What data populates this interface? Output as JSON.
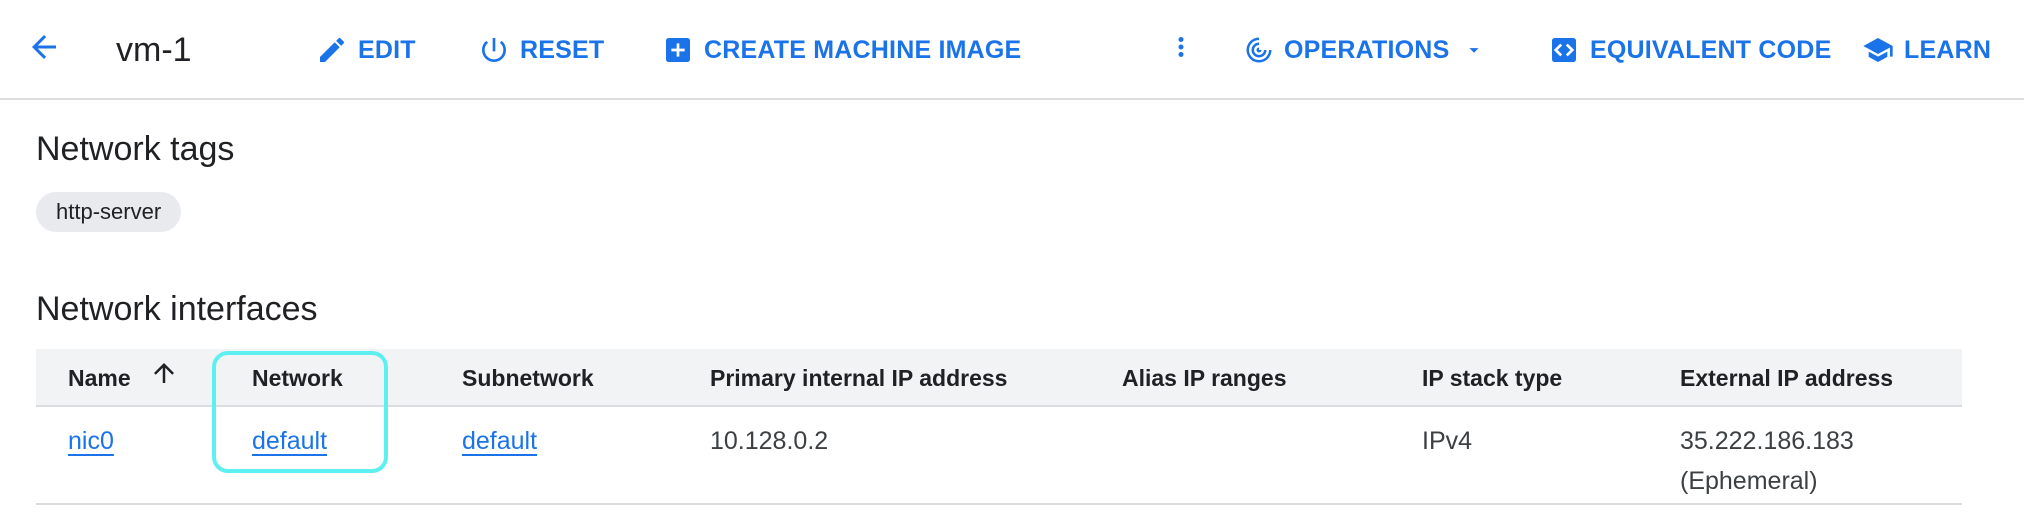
{
  "toolbar": {
    "title": "vm-1",
    "edit_label": "EDIT",
    "reset_label": "RESET",
    "create_image_label": "CREATE MACHINE IMAGE",
    "operations_label": "OPERATIONS",
    "equivalent_code_label": "EQUIVALENT CODE",
    "learn_label": "LEARN",
    "icons": [
      "back-arrow-icon",
      "pencil-icon",
      "power-icon",
      "add-box-icon",
      "more-vert-icon",
      "operations-icon",
      "dropdown-icon",
      "code-icon",
      "learn-icon"
    ]
  },
  "network_tags": {
    "heading": "Network tags",
    "tags": [
      "http-server"
    ]
  },
  "network_interfaces": {
    "heading": "Network interfaces",
    "columns": [
      "Name",
      "Network",
      "Subnetwork",
      "Primary internal IP address",
      "Alias IP ranges",
      "IP stack type",
      "External IP address"
    ],
    "sort_column": "Name",
    "sort_direction": "ascending",
    "rows": [
      {
        "name": "nic0",
        "network": "default",
        "subnetwork": "default",
        "primary_internal_ip": "10.128.0.2",
        "alias_ip_ranges": "",
        "ip_stack_type": "IPv4",
        "external_ip": "35.222.186.183",
        "external_ip_type": "(Ephemeral)"
      }
    ]
  },
  "colors": {
    "accent": "#1a73e8",
    "highlight": "#5ef0f0",
    "header_bg": "#f1f3f4",
    "chip_bg": "#e8eaed"
  }
}
